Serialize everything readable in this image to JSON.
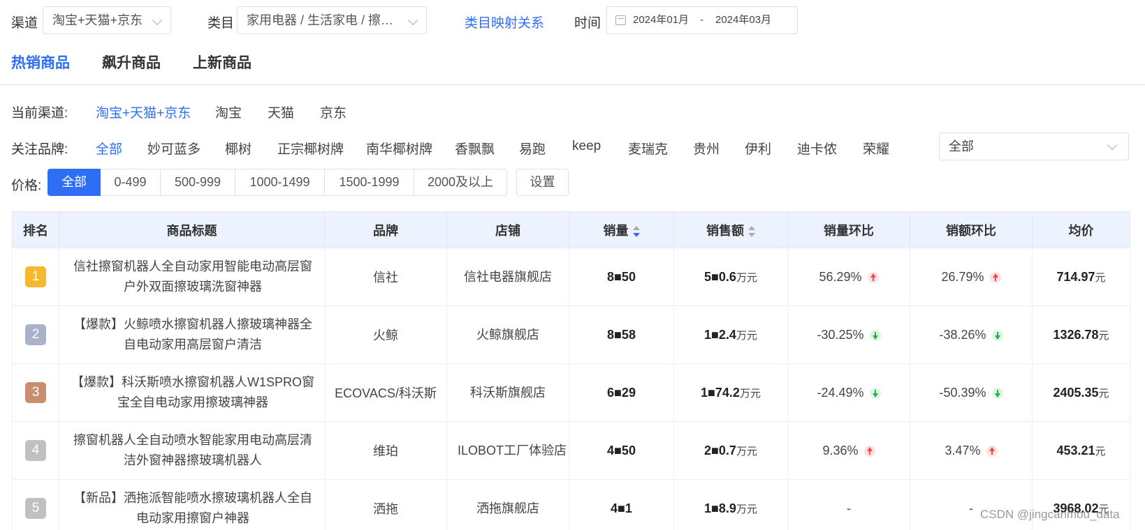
{
  "topbar": {
    "channel_label": "渠道",
    "channel_value": "淘宝+天猫+京东",
    "category_label": "类目",
    "category_value": "家用电器 / 生活家电 / 擦…",
    "category_map_link": "类目映射关系",
    "time_label": "时间",
    "date_start": "2024年01月",
    "date_sep": "-",
    "date_end": "2024年03月"
  },
  "tabs": [
    "热销商品",
    "飙升商品",
    "上新商品"
  ],
  "channel_filter": {
    "label": "当前渠道:",
    "options": [
      "淘宝+天猫+京东",
      "淘宝",
      "天猫",
      "京东"
    ]
  },
  "brand_filter": {
    "label": "关注品牌:",
    "options": [
      "全部",
      "妙可蓝多",
      "椰树",
      "正宗椰树牌",
      "南华椰树牌",
      "香飘飘",
      "易跑",
      "keep",
      "麦瑞克",
      "贵州",
      "伊利",
      "迪卡侬",
      "荣耀"
    ],
    "select_value": "全部"
  },
  "price_filter": {
    "label": "价格:",
    "options": [
      "全部",
      "0-499",
      "500-999",
      "1000-1499",
      "1500-1999",
      "2000及以上"
    ],
    "settings_label": "设置"
  },
  "table": {
    "headers": [
      "排名",
      "商品标题",
      "品牌",
      "店铺",
      "销量",
      "销售额",
      "销量环比",
      "销额环比",
      "均价"
    ],
    "unit_wan": "万元",
    "unit_yuan": "元",
    "rows": [
      {
        "rank": "1",
        "rank_color": "#f5b82e",
        "title": "信社擦窗机器人全自动家用智能电动高层窗户外双面擦玻璃洗窗神器",
        "brand": "信社",
        "shop": "信社电器旗舰店",
        "sales": "8■50",
        "revenue": "5■0.6",
        "sales_mom": "56.29%",
        "sales_dir": "up",
        "rev_mom": "26.79%",
        "rev_dir": "up",
        "avg": "714.97"
      },
      {
        "rank": "2",
        "rank_color": "#a9b2c8",
        "title": "【爆款】火鲸喷水擦窗机器人擦玻璃神器全自电动家用高层窗户清洁",
        "brand": "火鲸",
        "shop": "火鲸旗舰店",
        "sales": "8■58",
        "revenue": "1■2.4",
        "sales_mom": "-30.25%",
        "sales_dir": "down",
        "rev_mom": "-38.26%",
        "rev_dir": "down",
        "avg": "1326.78"
      },
      {
        "rank": "3",
        "rank_color": "#c98e6f",
        "title": "【爆款】科沃斯喷水擦窗机器人W1SPRO窗宝全自电动家用擦玻璃神器",
        "brand": "ECOVACS/科沃斯",
        "shop": "科沃斯旗舰店",
        "sales": "6■29",
        "revenue": "1■74.2",
        "sales_mom": "-24.49%",
        "sales_dir": "down",
        "rev_mom": "-50.39%",
        "rev_dir": "down",
        "avg": "2405.35"
      },
      {
        "rank": "4",
        "rank_color": "#c0c0c0",
        "title": "擦窗机器人全自动喷水智能家用电动高层清洁外窗神器擦玻璃机器人",
        "brand": "维珀",
        "shop": "ILOBOT工厂体验店",
        "sales": "4■50",
        "revenue": "2■0.7",
        "sales_mom": "9.36%",
        "sales_dir": "up",
        "rev_mom": "3.47%",
        "rev_dir": "up",
        "avg": "453.21"
      },
      {
        "rank": "5",
        "rank_color": "#c0c0c0",
        "title": "【新品】洒拖派智能喷水擦玻璃机器人全自电动家用擦窗户神器",
        "brand": "洒拖",
        "shop": "洒拖旗舰店",
        "sales": "4■1",
        "revenue": "1■8.9",
        "sales_mom": "-",
        "sales_dir": "",
        "rev_mom": "-",
        "rev_dir": "",
        "avg": "3968.02"
      }
    ]
  },
  "watermark": "CSDN @jingcanmou_data"
}
